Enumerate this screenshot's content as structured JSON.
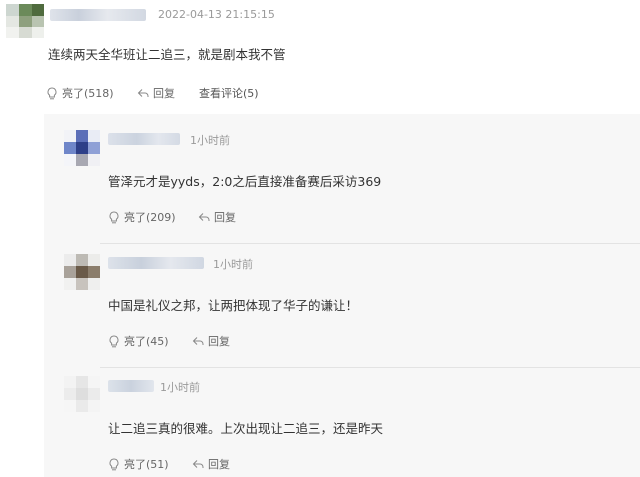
{
  "top_comment": {
    "timestamp": "2022-04-13 21:15:15",
    "text": "连续两天全华班让二追三，就是剧本我不管",
    "like_label": "亮了(518)",
    "reply_label": "回复",
    "view_replies_label": "查看评论(5)"
  },
  "replies": [
    {
      "timestamp": "1小时前",
      "text": "管泽元才是yyds，2:0之后直接准备赛后采访369",
      "like_label": "亮了(209)",
      "reply_label": "回复"
    },
    {
      "timestamp": "1小时前",
      "text": "中国是礼仪之邦，让两把体现了华子的谦让！",
      "like_label": "亮了(45)",
      "reply_label": "回复"
    },
    {
      "timestamp": "1小时前",
      "text": "让二追三真的很难。上次出现让二追三，还是昨天",
      "like_label": "亮了(51)",
      "reply_label": "回复"
    }
  ],
  "icons": {
    "like": "lightbulb-icon",
    "reply": "reply-arrow-icon"
  },
  "colors": {
    "text": "#333333",
    "meta": "#9a9a9a",
    "action": "#666666",
    "panel_bg": "#f7f7f7"
  }
}
